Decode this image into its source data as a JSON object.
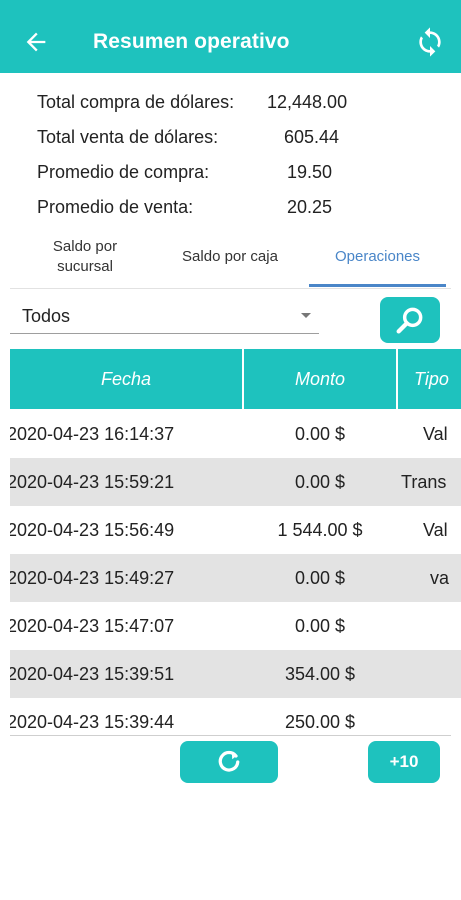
{
  "header": {
    "title": "Resumen operativo",
    "back_icon": "arrow-left-icon",
    "refresh_icon": "refresh-icon"
  },
  "summary": [
    {
      "label": "Total compra de dólares:",
      "value": "12,448.00"
    },
    {
      "label": "Total venta de dólares:",
      "value": "605.44"
    },
    {
      "label": "Promedio de compra:",
      "value": "19.50"
    },
    {
      "label": "Promedio de venta:",
      "value": "20.25"
    }
  ],
  "tabs": [
    {
      "label": "Saldo por sucursal",
      "active": false
    },
    {
      "label": "Saldo por caja",
      "active": false
    },
    {
      "label": "Operaciones",
      "active": true
    }
  ],
  "filter": {
    "selected": "Todos"
  },
  "table": {
    "columns": [
      "Fecha",
      "Monto",
      "Tipo"
    ],
    "rows": [
      {
        "fecha": "2020-04-23 16:14:37",
        "monto": "0.00 $",
        "tipo": "Val"
      },
      {
        "fecha": "2020-04-23 15:59:21",
        "monto": "0.00 $",
        "tipo": "Trans"
      },
      {
        "fecha": "2020-04-23 15:56:49",
        "monto": "1 544.00 $",
        "tipo": "Val"
      },
      {
        "fecha": "2020-04-23 15:49:27",
        "monto": "0.00 $",
        "tipo": "va"
      },
      {
        "fecha": "2020-04-23 15:47:07",
        "monto": "0.00 $",
        "tipo": ""
      },
      {
        "fecha": "2020-04-23 15:39:51",
        "monto": "354.00 $",
        "tipo": ""
      },
      {
        "fecha": "2020-04-23 15:39:44",
        "monto": "250.00 $",
        "tipo": ""
      }
    ]
  },
  "actions": {
    "reload_icon": "reload-icon",
    "more_label": "+10"
  },
  "colors": {
    "primary": "#1ec2be",
    "tab_active": "#4a86c8",
    "row_alt": "#e3e3e3"
  }
}
